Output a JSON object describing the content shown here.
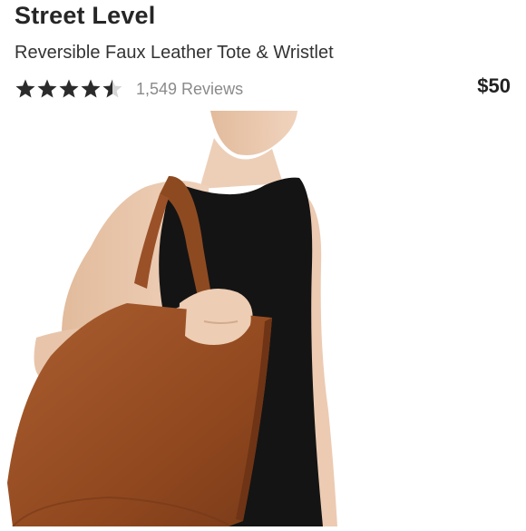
{
  "product": {
    "brand": "Street Level",
    "name": "Reversible Faux Leather Tote & Wristlet",
    "rating": 4.5,
    "rating_max": 5,
    "reviews_label": "1,549 Reviews",
    "price": "$50"
  },
  "icons": {
    "star_full": "star-icon",
    "star_half": "half-star-icon"
  },
  "colors": {
    "text_primary": "#262626",
    "text_secondary": "#8a8a8a",
    "star": "#2b2b2b",
    "bag": "#9a5128",
    "dress": "#141414",
    "skin": "#e9c8ad"
  }
}
